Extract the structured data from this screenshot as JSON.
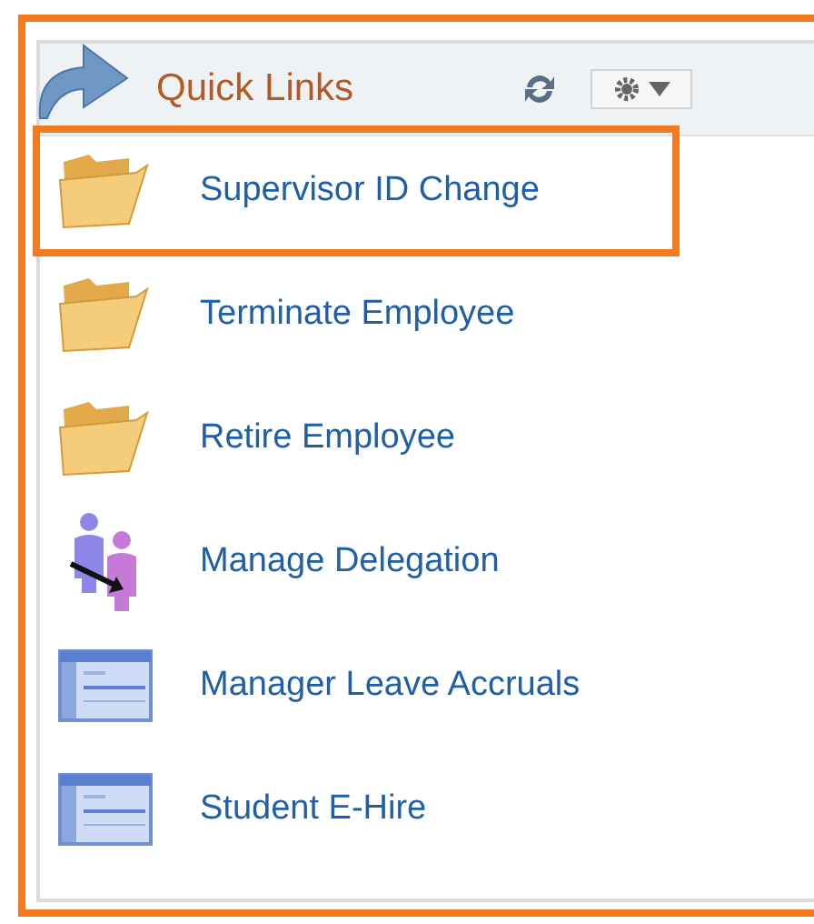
{
  "pagelet": {
    "title": "Quick Links",
    "items": [
      {
        "label": "Supervisor ID Change",
        "kind": "folder",
        "highlighted": true
      },
      {
        "label": "Terminate Employee",
        "kind": "folder",
        "highlighted": false
      },
      {
        "label": "Retire Employee",
        "kind": "folder",
        "highlighted": false
      },
      {
        "label": "Manage Delegation",
        "kind": "delegation",
        "highlighted": false
      },
      {
        "label": "Manager Leave Accruals",
        "kind": "page",
        "highlighted": false
      },
      {
        "label": "Student E-Hire",
        "kind": "page",
        "highlighted": false
      }
    ]
  }
}
